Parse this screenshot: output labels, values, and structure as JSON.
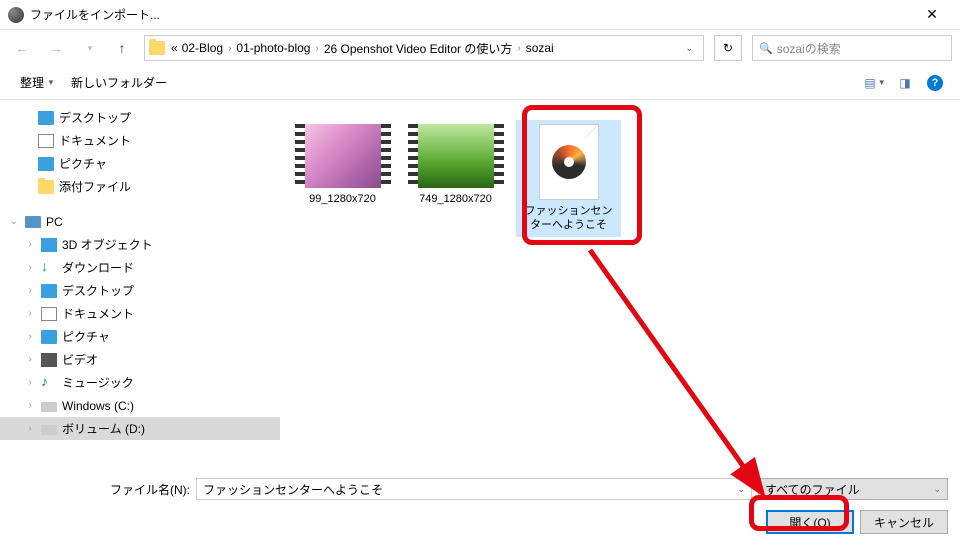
{
  "window": {
    "title": "ファイルをインポート..."
  },
  "nav": {
    "crumbs": [
      "02-Blog",
      "01-photo-blog",
      "26 Openshot Video Editor の使い方",
      "sozai"
    ],
    "prefix": "«"
  },
  "search": {
    "placeholder": "sozaiの検索"
  },
  "toolbar": {
    "organize": "整理",
    "newfolder": "新しいフォルダー"
  },
  "tree": {
    "quick": [
      {
        "label": "デスクトップ",
        "ico": "desktop"
      },
      {
        "label": "ドキュメント",
        "ico": "doc"
      },
      {
        "label": "ピクチャ",
        "ico": "pics"
      },
      {
        "label": "添付ファイル",
        "ico": "folder"
      }
    ],
    "pc_label": "PC",
    "pc": [
      {
        "label": "3D オブジェクト",
        "ico": "obj3d"
      },
      {
        "label": "ダウンロード",
        "ico": "dl"
      },
      {
        "label": "デスクトップ",
        "ico": "desktop"
      },
      {
        "label": "ドキュメント",
        "ico": "doc"
      },
      {
        "label": "ピクチャ",
        "ico": "pics"
      },
      {
        "label": "ビデオ",
        "ico": "video"
      },
      {
        "label": "ミュージック",
        "ico": "music"
      },
      {
        "label": "Windows (C:)",
        "ico": "drive"
      },
      {
        "label": "ボリューム (D:)",
        "ico": "drive",
        "selected": true
      }
    ]
  },
  "files": [
    {
      "label": "99_1280x720",
      "type": "video1"
    },
    {
      "label": "749_1280x720",
      "type": "video2"
    },
    {
      "label": "ファッションセンターへようこそ",
      "type": "audio",
      "selected": true
    }
  ],
  "footer": {
    "filename_label": "ファイル名(N):",
    "filename_value": "ファッションセンターへようこそ",
    "filter": "すべてのファイル",
    "open": "開く(O)",
    "cancel": "キャンセル"
  }
}
